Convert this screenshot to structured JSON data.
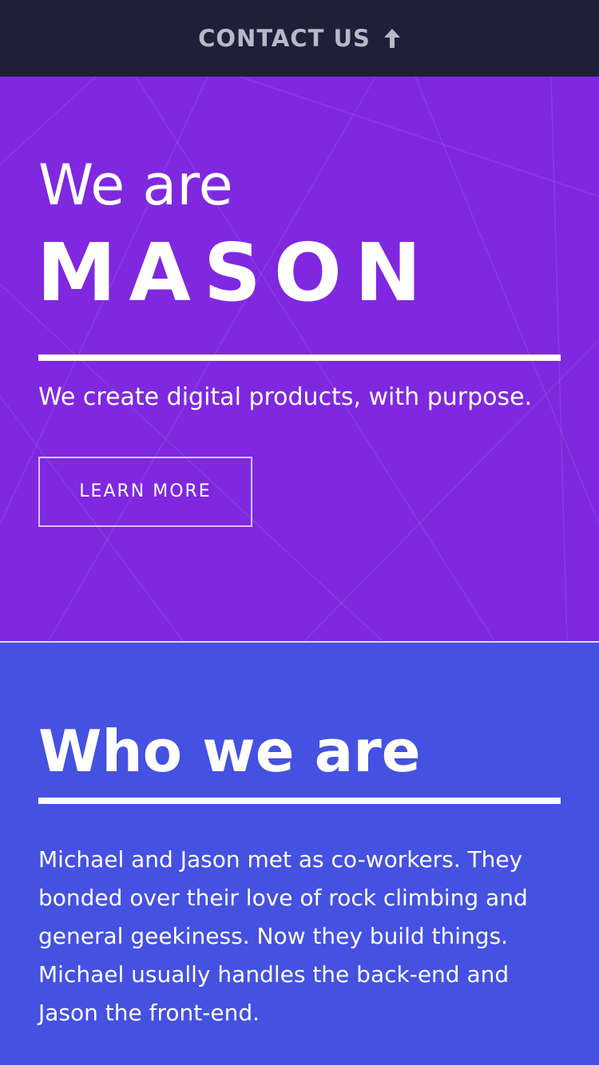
{
  "header": {
    "contact_label": "CONTACT US",
    "arrow_icon": "arrow-up-icon",
    "background": "#1f1f3a"
  },
  "hero": {
    "intro": "We are",
    "brand": "MASON",
    "tagline": "We create digital products, with purpose.",
    "cta_label": "LEARN MORE",
    "background": "#7f28df"
  },
  "about": {
    "title": "Who we are",
    "body": "Michael and Jason met as co-workers. They bonded over their love of rock climbing and general geekiness. Now they build things. Michael usually handles the back-end and Jason the front-end.",
    "background": "#4551e0"
  }
}
